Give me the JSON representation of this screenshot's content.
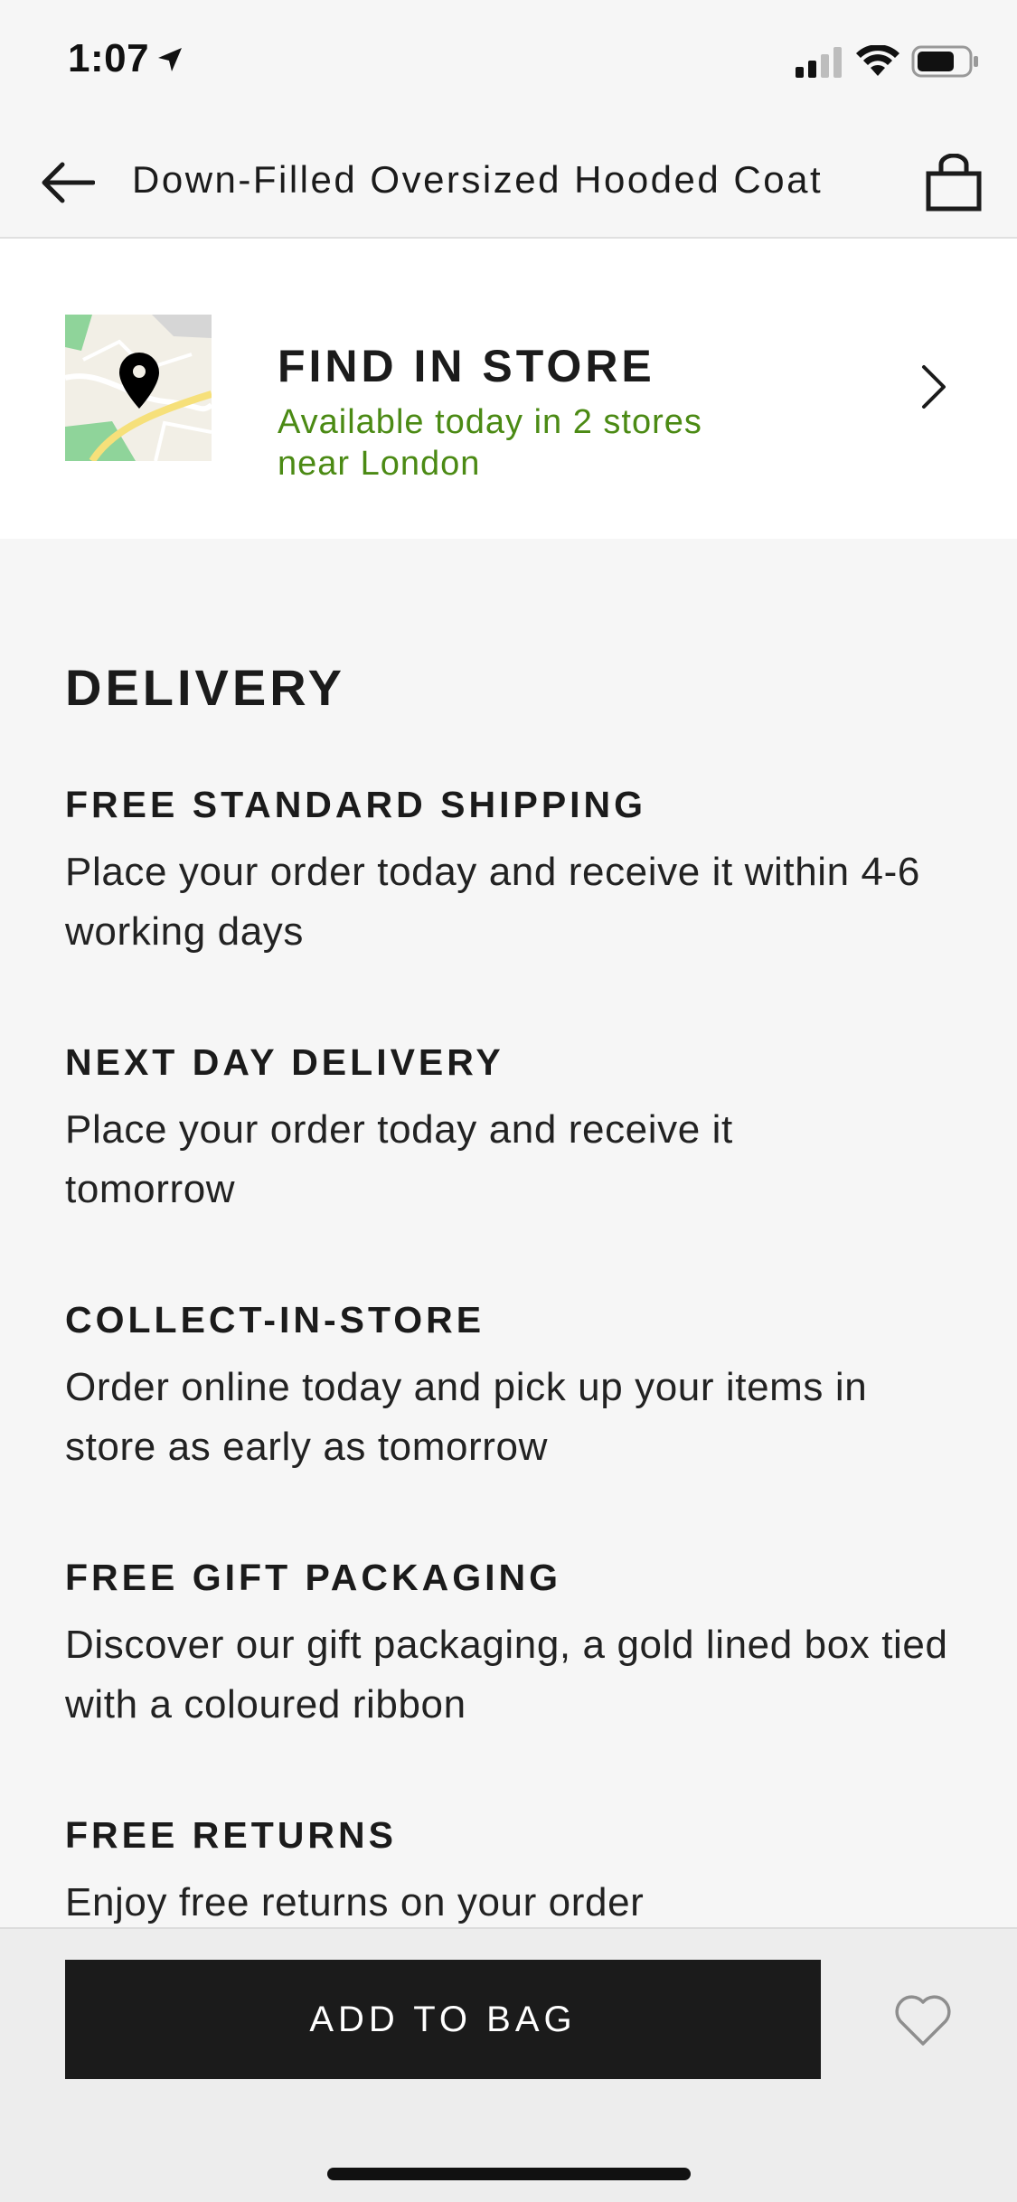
{
  "status_bar": {
    "time": "1:07"
  },
  "header": {
    "title": "Down-Filled Oversized Hooded Coat",
    "back_icon": "arrow-left-icon",
    "bag_icon": "shopping-bag-icon"
  },
  "find_in_store": {
    "title": "FIND IN STORE",
    "availability": "Available today in 2 stores near London",
    "availability_color": "#4b8a14"
  },
  "delivery": {
    "heading": "DELIVERY",
    "items": [
      {
        "title": "FREE STANDARD SHIPPING",
        "description": "Place your order today and receive it within 4-6 working days"
      },
      {
        "title": "NEXT DAY DELIVERY",
        "description": "Place your order today and receive it tomorrow"
      },
      {
        "title": "COLLECT-IN-STORE",
        "description": "Order online today and pick up your items in store as early as tomorrow"
      },
      {
        "title": "FREE GIFT PACKAGING",
        "description": "Discover our gift packaging, a gold lined box tied with a coloured ribbon"
      },
      {
        "title": "FREE RETURNS",
        "description": "Enjoy free returns on your order"
      }
    ]
  },
  "footer": {
    "add_to_bag_label": "ADD TO BAG",
    "wishlist_icon": "heart-icon"
  }
}
